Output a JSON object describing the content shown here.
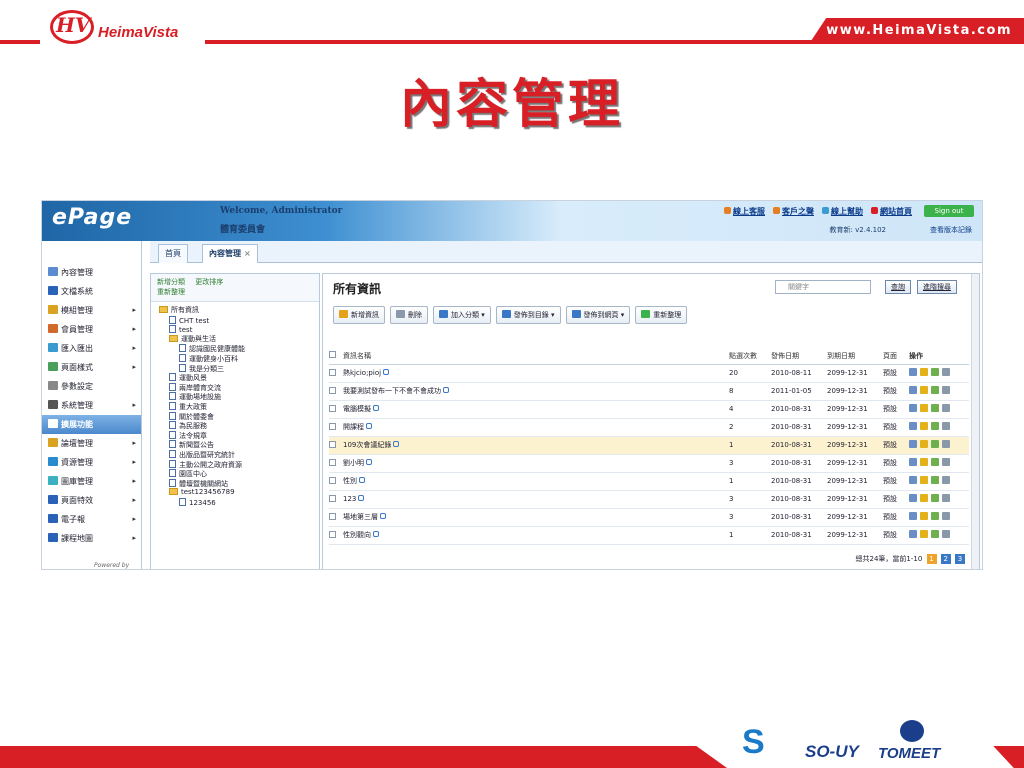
{
  "slide": {
    "brand_mark": "HV",
    "brand_name": "HeimaVista",
    "url": "www.HeimaVista.com",
    "title": "內容管理",
    "partners": [
      "S",
      "SO-UY",
      "TOMEET"
    ]
  },
  "app": {
    "logo": "ePage",
    "welcome": "Welcome, Administrator",
    "org": "體育委員會",
    "toplinks": [
      "線上客服",
      "客戶之聲",
      "線上幫助",
      "網站首頁"
    ],
    "signout": "Sign out",
    "version": "教育新: v2.4.102",
    "changelog": "查看版本記錄",
    "tabs": [
      {
        "label": "首頁"
      },
      {
        "label": "內容管理",
        "close": "×"
      }
    ],
    "nav": [
      {
        "label": "內容管理",
        "arrow": "",
        "color": "#5b8bd0"
      },
      {
        "label": "文檔系統",
        "arrow": "",
        "color": "#2a62b8"
      },
      {
        "label": "模組管理",
        "arrow": "▸",
        "color": "#d9a221"
      },
      {
        "label": "會員管理",
        "arrow": "▸",
        "color": "#d06a2a"
      },
      {
        "label": "匯入匯出",
        "arrow": "▸",
        "color": "#3a9bd0"
      },
      {
        "label": "頁面樣式",
        "arrow": "▸",
        "color": "#4aa05a"
      },
      {
        "label": "參數設定",
        "arrow": "",
        "color": "#888888"
      },
      {
        "label": "系統管理",
        "arrow": "▸",
        "color": "#555555"
      },
      {
        "label": "擴展功能",
        "arrow": "",
        "color": "#ffffff",
        "active": true
      },
      {
        "label": "論壇管理",
        "arrow": "▸",
        "color": "#d9a221"
      },
      {
        "label": "資源管理",
        "arrow": "▸",
        "color": "#2a8ad0"
      },
      {
        "label": "圖庫管理",
        "arrow": "▸",
        "color": "#3ab0c0"
      },
      {
        "label": "頁面特效",
        "arrow": "▸",
        "color": "#2a62b8"
      },
      {
        "label": "電子報",
        "arrow": "▸",
        "color": "#2a62b8"
      },
      {
        "label": "課程地圖",
        "arrow": "▸",
        "color": "#2a62b8"
      }
    ],
    "powered": "Powered by",
    "tree": {
      "actions": [
        "新增分類",
        "更改排序",
        "重新整理"
      ],
      "items": [
        {
          "label": "所有資訊",
          "type": "fold",
          "indent": 0
        },
        {
          "label": "CHT test",
          "type": "doc",
          "indent": 1
        },
        {
          "label": "test",
          "type": "doc",
          "indent": 1
        },
        {
          "label": "運動與生活",
          "type": "fold",
          "indent": 1
        },
        {
          "label": "認識國民健康體能",
          "type": "doc",
          "indent": 2
        },
        {
          "label": "運動健身小百科",
          "type": "doc",
          "indent": 2
        },
        {
          "label": "我是分類三",
          "type": "doc",
          "indent": 2
        },
        {
          "label": "運動风景",
          "type": "doc",
          "indent": 1
        },
        {
          "label": "兩岸體育交流",
          "type": "doc",
          "indent": 1
        },
        {
          "label": "運動場地設施",
          "type": "doc",
          "indent": 1
        },
        {
          "label": "重大政策",
          "type": "doc",
          "indent": 1
        },
        {
          "label": "關於體委會",
          "type": "doc",
          "indent": 1
        },
        {
          "label": "為民服務",
          "type": "doc",
          "indent": 1
        },
        {
          "label": "法令規章",
          "type": "doc",
          "indent": 1
        },
        {
          "label": "新聞暨公告",
          "type": "doc",
          "indent": 1
        },
        {
          "label": "出版品暨研究統計",
          "type": "doc",
          "indent": 1
        },
        {
          "label": "主動公開之政府資源",
          "type": "doc",
          "indent": 1
        },
        {
          "label": "園區中心",
          "type": "doc",
          "indent": 1
        },
        {
          "label": "體壇暨機關網站",
          "type": "doc",
          "indent": 1
        },
        {
          "label": "test123456789",
          "type": "fold",
          "indent": 1
        },
        {
          "label": "123456",
          "type": "doc",
          "indent": 2
        }
      ]
    },
    "main": {
      "title": "所有資訊",
      "search_placeholder": "關鍵字",
      "search_button": "查詢",
      "advanced_button": "進階搜尋",
      "toolbar": [
        "新增資訊",
        "刪除",
        "加入分類 ▾",
        "發佈到目錄 ▾",
        "發佈到網頁 ▾",
        "重新整理"
      ],
      "columns": [
        "資訊名稱",
        "點選次數",
        "發佈日期",
        "到期日期",
        "頁面",
        "操作"
      ],
      "rows": [
        {
          "name": "熱kjcio;pioj",
          "views": "20",
          "pub": "2010-08-11",
          "exp": "2099-12-31",
          "page": "預設"
        },
        {
          "name": "我要測試發布一下不會不會成功",
          "views": "8",
          "pub": "2011-01-05",
          "exp": "2099-12-31",
          "page": "預設"
        },
        {
          "name": "電腦模擬",
          "views": "4",
          "pub": "2010-08-31",
          "exp": "2099-12-31",
          "page": "預設"
        },
        {
          "name": "開課程",
          "views": "2",
          "pub": "2010-08-31",
          "exp": "2099-12-31",
          "page": "預設"
        },
        {
          "name": "109次會議紀錄",
          "views": "1",
          "pub": "2010-08-31",
          "exp": "2099-12-31",
          "page": "預設",
          "highlight": true
        },
        {
          "name": "劉小明",
          "views": "3",
          "pub": "2010-08-31",
          "exp": "2099-12-31",
          "page": "預設"
        },
        {
          "name": "性別",
          "views": "1",
          "pub": "2010-08-31",
          "exp": "2099-12-31",
          "page": "預設"
        },
        {
          "name": "123",
          "views": "3",
          "pub": "2010-08-31",
          "exp": "2099-12-31",
          "page": "預設"
        },
        {
          "name": "場地第三層",
          "views": "3",
          "pub": "2010-08-31",
          "exp": "2099-12-31",
          "page": "預設"
        },
        {
          "name": "性別觀向",
          "views": "1",
          "pub": "2010-08-31",
          "exp": "2099-12-31",
          "page": "預設"
        }
      ],
      "pager_text": "總共24筆，當前1-10",
      "pages": [
        "1",
        "2",
        "3"
      ]
    }
  }
}
